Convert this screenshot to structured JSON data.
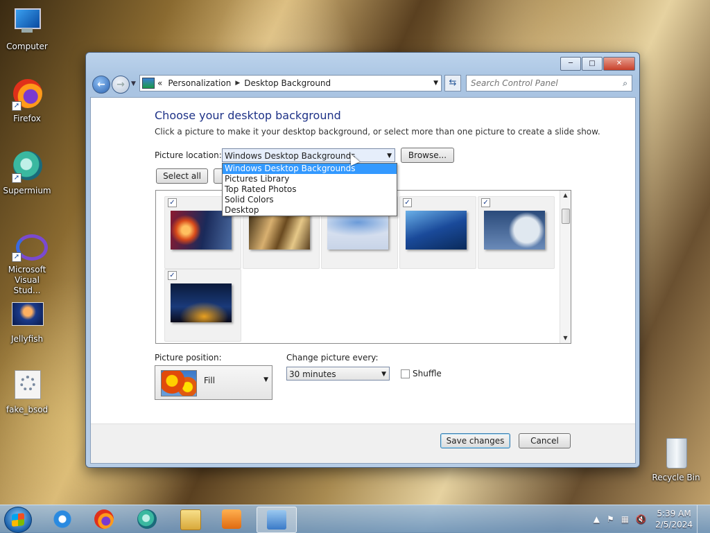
{
  "desktop": {
    "icons": [
      {
        "label": "Computer",
        "icon": "computer-icon"
      },
      {
        "label": "Firefox",
        "icon": "firefox-icon"
      },
      {
        "label": "Supermium",
        "icon": "supermium-icon"
      },
      {
        "label": "Microsoft Visual Stud...",
        "icon": "visual-studio-icon"
      },
      {
        "label": "Jellyfish",
        "icon": "jellyfish-image-icon"
      },
      {
        "label": "fake_bsod",
        "icon": "gear-file-icon"
      },
      {
        "label": "Recycle Bin",
        "icon": "recycle-bin-icon"
      }
    ]
  },
  "window": {
    "title_buttons": {
      "minimize": "─",
      "maximize": "□",
      "close": "✕"
    },
    "nav": {
      "back": "←",
      "forward": "→",
      "breadcrumb_prefix": "«",
      "breadcrumb": [
        "Personalization",
        "Desktop Background"
      ],
      "search_placeholder": "Search Control Panel"
    },
    "heading": "Choose your desktop background",
    "intro": "Click a picture to make it your desktop background, or select more than one picture to create a slide show.",
    "picture_location": {
      "label": "Picture location:",
      "value": "Windows Desktop Backgrounds",
      "browse": "Browse...",
      "options": [
        "Windows Desktop Backgrounds",
        "Pictures Library",
        "Top Rated Photos",
        "Solid Colors",
        "Desktop"
      ],
      "highlighted_index": 0
    },
    "select_all": "Select all",
    "thumbnails": [
      {
        "checked": true,
        "colors": [
          "#d84a1a",
          "#1a2a5a"
        ]
      },
      {
        "checked": true,
        "colors": [
          "#6a4a20",
          "#d8b070"
        ]
      },
      {
        "checked": true,
        "colors": [
          "#6a9ad8",
          "#e8eef8"
        ]
      },
      {
        "checked": true,
        "colors": [
          "#1a4a9a",
          "#6ab0e8"
        ]
      },
      {
        "checked": true,
        "colors": [
          "#2a4a7a",
          "#c8d4e4"
        ]
      },
      {
        "checked": true,
        "colors": [
          "#0a1a3a",
          "#e8a020"
        ]
      }
    ],
    "picture_position": {
      "label": "Picture position:",
      "value": "Fill"
    },
    "change_every": {
      "label": "Change picture every:",
      "value": "30 minutes"
    },
    "shuffle": {
      "label": "Shuffle",
      "checked": false
    },
    "save": "Save changes",
    "cancel": "Cancel"
  },
  "taskbar": {
    "apps": [
      "internet-explorer-icon",
      "firefox-icon",
      "supermium-icon",
      "file-explorer-icon",
      "media-player-icon",
      "control-panel-icon"
    ],
    "clock": {
      "time": "5:39 AM",
      "date": "2/5/2024"
    }
  }
}
